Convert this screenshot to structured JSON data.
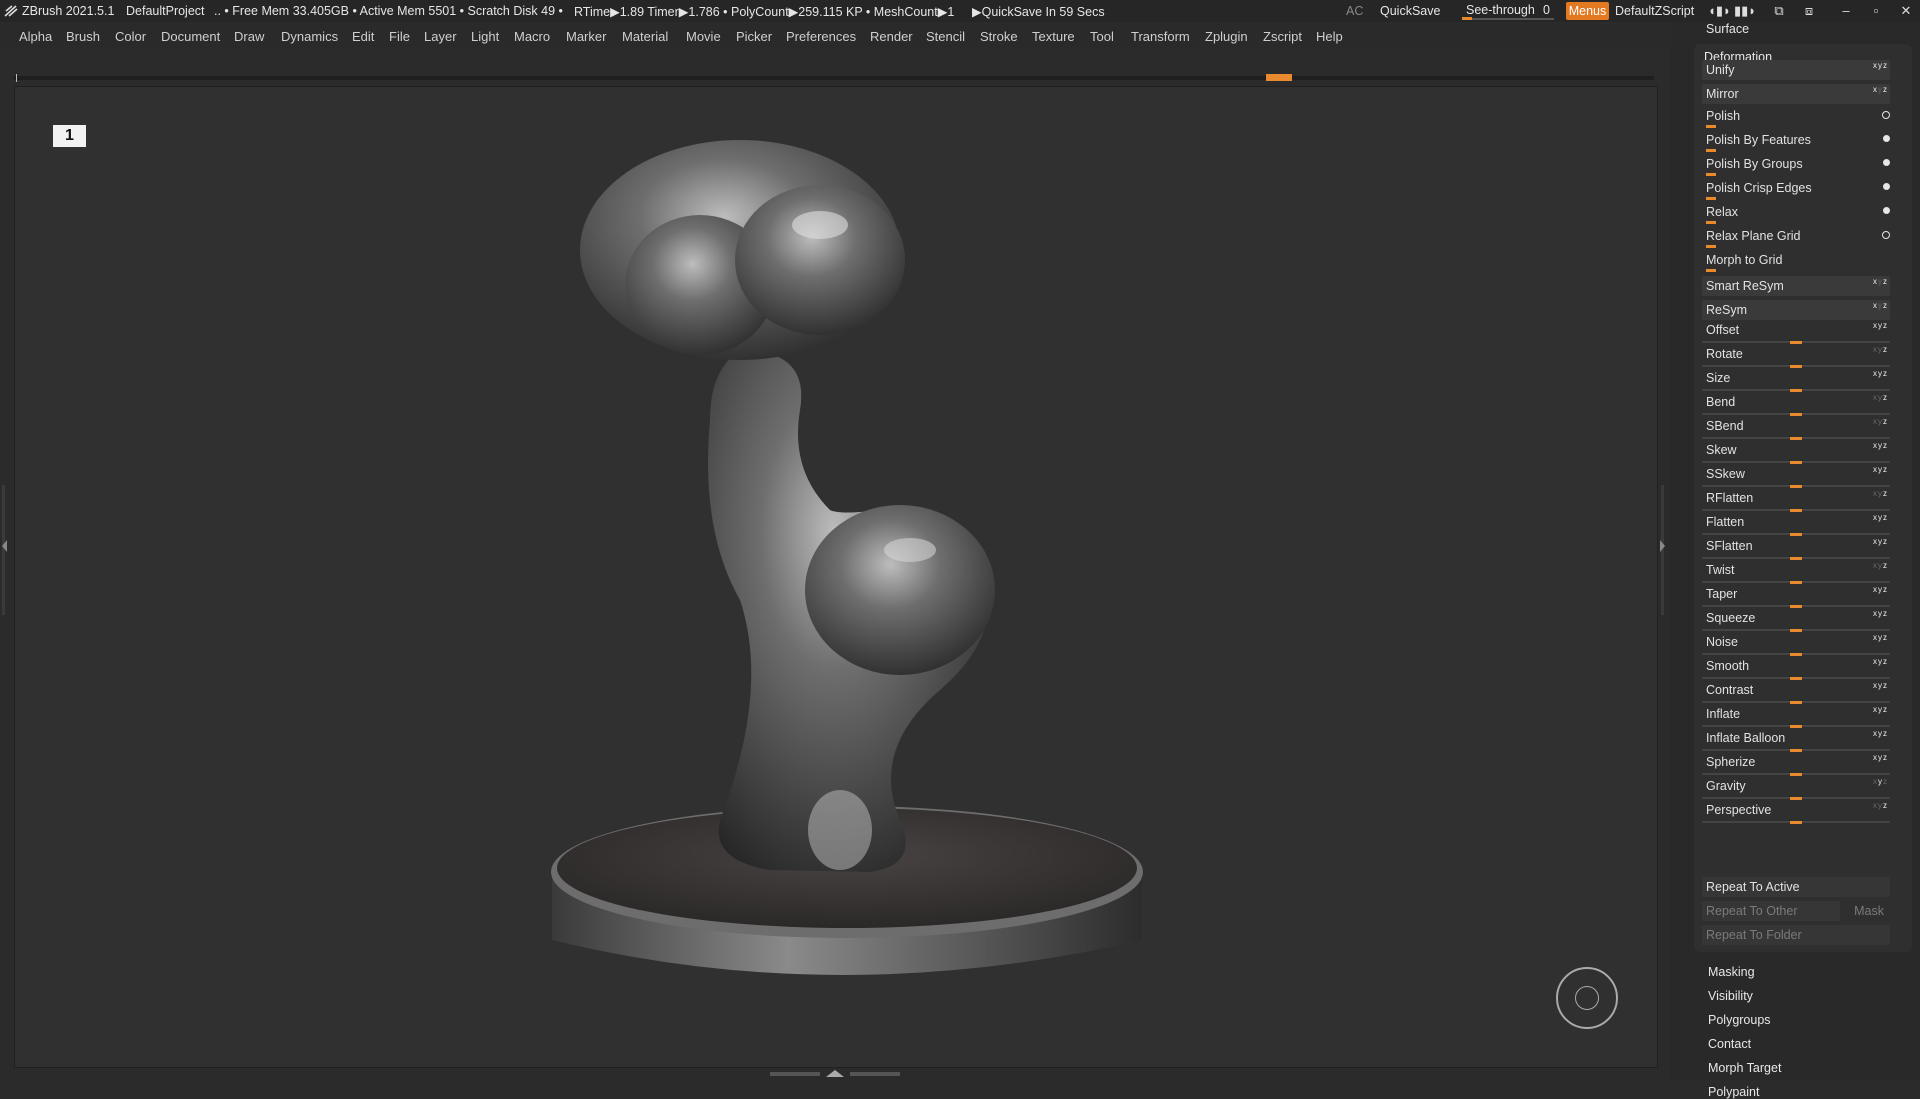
{
  "titlebar": {
    "app": "ZBrush 2021.5.1",
    "project": "DefaultProject",
    "status": ".. • Free Mem 33.405GB • Active Mem 5501 • Scratch Disk 49 •",
    "rtime": "RTime▶1.89 Timer▶1.786 • PolyCount▶259.115 KP • MeshCount▶1",
    "quicksave_timer": "▶QuickSave In 59 Secs",
    "ac": "AC",
    "quicksave": "QuickSave",
    "see_through_label": "See-through",
    "see_through_value": "0",
    "menus": "Menus",
    "script": "DefaultZScript"
  },
  "menubar": [
    "Alpha",
    "Brush",
    "Color",
    "Document",
    "Draw",
    "Dynamics",
    "Edit",
    "File",
    "Layer",
    "Light",
    "Macro",
    "Marker",
    "Material",
    "Movie",
    "Picker",
    "Preferences",
    "Render",
    "Stencil",
    "Stroke",
    "Texture",
    "Tool",
    "Transform",
    "Zplugin",
    "Zscript",
    "Help"
  ],
  "viewport": {
    "badge": "1",
    "accent": "#e98a2e"
  },
  "panel": {
    "surface": "Surface",
    "deformation": "Deformation",
    "top_buttons": [
      {
        "label": "Unify",
        "kind": "xyz"
      },
      {
        "label": "Mirror",
        "kind": "xyz"
      },
      {
        "label": "Polish",
        "kind": "ring"
      },
      {
        "label": "Polish By Features",
        "kind": "dot"
      },
      {
        "label": "Polish By Groups",
        "kind": "dot"
      },
      {
        "label": "Polish Crisp Edges",
        "kind": "dot"
      },
      {
        "label": "Relax",
        "kind": "dot"
      },
      {
        "label": "Relax Plane Grid",
        "kind": "ring"
      },
      {
        "label": "Morph to Grid",
        "kind": "none"
      },
      {
        "label": "Smart ReSym",
        "kind": "xyz"
      },
      {
        "label": "ReSym",
        "kind": "xyz"
      }
    ],
    "sliders": [
      {
        "label": "Offset",
        "value": 0
      },
      {
        "label": "Rotate",
        "value": 0
      },
      {
        "label": "Size",
        "value": 0
      },
      {
        "label": "Bend",
        "value": 0
      },
      {
        "label": "SBend",
        "value": 0
      },
      {
        "label": "Skew",
        "value": 0
      },
      {
        "label": "SSkew",
        "value": 0
      },
      {
        "label": "RFlatten",
        "value": 0
      },
      {
        "label": "Flatten",
        "value": 0
      },
      {
        "label": "SFlatten",
        "value": 0
      },
      {
        "label": "Twist",
        "value": 0
      },
      {
        "label": "Taper",
        "value": 0
      },
      {
        "label": "Squeeze",
        "value": 0
      },
      {
        "label": "Noise",
        "value": 0
      },
      {
        "label": "Smooth",
        "value": 0
      },
      {
        "label": "Contrast",
        "value": 0
      },
      {
        "label": "Inflate",
        "value": 0
      },
      {
        "label": "Inflate Balloon",
        "value": 0
      },
      {
        "label": "Spherize",
        "value": 0
      },
      {
        "label": "Gravity",
        "value": 0
      },
      {
        "label": "Perspective",
        "value": 0
      }
    ],
    "repeat_active": "Repeat To Active",
    "repeat_other": "Repeat To Other",
    "mask": "Mask",
    "repeat_folder": "Repeat To Folder",
    "subpalettes": [
      "Masking",
      "Visibility",
      "Polygroups",
      "Contact",
      "Morph Target",
      "Polypaint"
    ]
  }
}
